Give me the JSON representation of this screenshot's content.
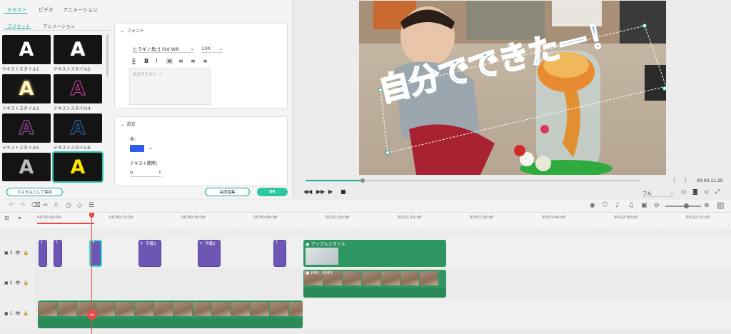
{
  "tabs": {
    "text": "テキスト",
    "video": "ビデオ",
    "animation": "アニメーション"
  },
  "subtabs": {
    "preset": "プリセット",
    "animation": "アニメーション"
  },
  "presets": [
    {
      "label": "テキストスタイル1",
      "letter": "A"
    },
    {
      "label": "テキストスタイル2",
      "letter": "A"
    },
    {
      "label": "テキストスタイル3",
      "letter": "A"
    },
    {
      "label": "テキストスタイル4",
      "letter": "A"
    },
    {
      "label": "テキストスタイル5",
      "letter": "A"
    },
    {
      "label": "テキストスタイル6",
      "letter": "A"
    },
    {
      "label": "",
      "letter": "A"
    },
    {
      "label": "",
      "letter": "A"
    }
  ],
  "font_section": {
    "title": "フォント",
    "font": "ヒラギノ角ゴ Std W8",
    "size": "130",
    "placeholder": "自分でできたー！"
  },
  "settings_section": {
    "title": "設定",
    "color_label": "色：",
    "spacing_label": "テキスト間隔：",
    "spacing_value": "0"
  },
  "buttons": {
    "save_custom": "カスタムとして保存",
    "advanced": "高度編集",
    "ok": "OK"
  },
  "overlay_text": "自分でできたー！",
  "player": {
    "time": "00:00:11:20",
    "quality": "フル",
    "progress": 0.17
  },
  "ruler_ticks": [
    "00:00:00:00",
    "00:00:15:00",
    "00:00:30:00",
    "00:00:45:00",
    "00:01:00:00",
    "00:01:15:00",
    "00:01:30:00",
    "00:01:45:00",
    "00:02:00:00",
    "00:02:15:00"
  ],
  "tracks": [
    {
      "name": "3"
    },
    {
      "name": "2"
    },
    {
      "name": "1"
    }
  ],
  "clips": {
    "subtitle1": "字幕2",
    "subtitle2": "字幕2",
    "apple": "アップルスタイル",
    "img": "IMG_3343"
  },
  "colors": {
    "accent": "#1aa89a",
    "purple": "#6e56b4",
    "green": "#2e9660",
    "playhead": "#e84a4a",
    "text_color": "#2c5cf0"
  }
}
